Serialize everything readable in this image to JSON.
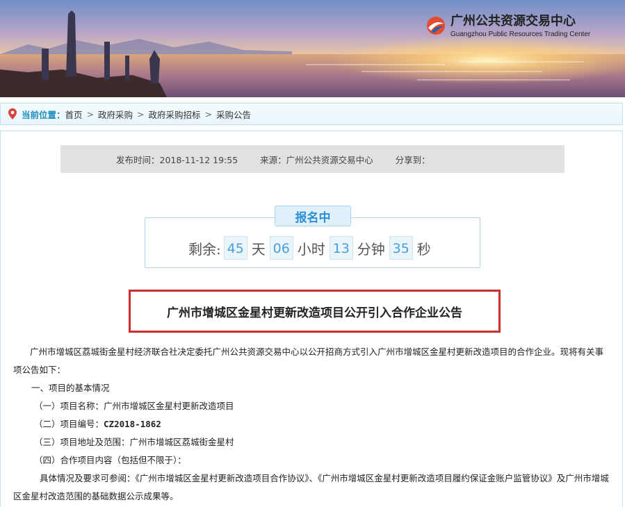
{
  "header": {
    "logo_cn": "广州公共资源交易中心",
    "logo_en": "Guangzhou Public Resources Trading Center",
    "accent": "#1a8dbf"
  },
  "breadcrumb": {
    "label": "当前位置：",
    "items": [
      "首页",
      "政府采购",
      "政府采购招标",
      "采购公告"
    ],
    "separator": ">"
  },
  "meta": {
    "publish_time": "发布时间：2018-11-12 19:55",
    "source": "来源：广州公共资源交易中心",
    "share": "分享到："
  },
  "countdown": {
    "status": "报名中",
    "prefix": "剩余:",
    "days": "45",
    "days_unit": "天",
    "hours": "06",
    "hours_unit": "小时",
    "minutes": "13",
    "minutes_unit": "分钟",
    "seconds": "35",
    "seconds_unit": "秒"
  },
  "announcement": {
    "title": "广州市增城区金星村更新改造项目公开引入合作企业公告",
    "intro": "广州市增城区荔城街金星村经济联合社决定委托广州公共资源交易中心以公开招商方式引入广州市增城区金星村更新改造项目的合作企业。现将有关事项公告如下：",
    "section1": "一、项目的基本情况",
    "item1_label": "（一）项目名称：",
    "item1_value": "广州市增城区金星村更新改造项目",
    "item2_label": "（二）项目编号：",
    "item2_value": "CZ2018-1862",
    "item3_label": "（三）项目地址及范围：",
    "item3_value": "广州市增城区荔城街金星村",
    "item4": "（四）合作项目内容（包括但不限于）：",
    "detail": "具体情况及要求可参阅：《广州市增城区金星村更新改造项目合作协议》、《广州市增城区金星村更新改造项目履约保证金账户监管协议》及广州市增城区金星村改造范围的基础数据公示成果等。"
  },
  "colors": {
    "title_border": "#c9302c",
    "countdown_blue": "#2d8fd5",
    "meta_bg": "#e1e1e1"
  }
}
